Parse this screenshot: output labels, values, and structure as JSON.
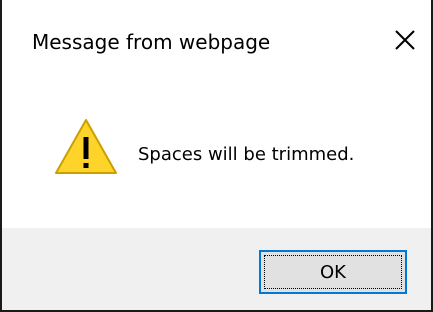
{
  "dialog": {
    "title": "Message from webpage",
    "message": "Spaces will be trimmed.",
    "icon": "warning-icon",
    "ok_label": "OK",
    "close_icon": "close-icon"
  },
  "colors": {
    "warning_fill": "#ffd42a",
    "ok_border_focus": "#0078d7",
    "footer_background": "#f0f0f0"
  }
}
